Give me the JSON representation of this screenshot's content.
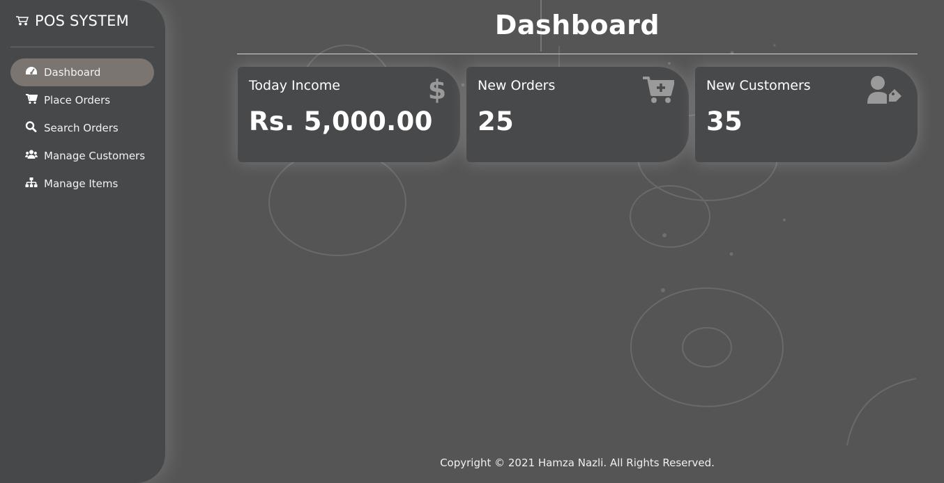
{
  "app": {
    "brand": "POS SYSTEM",
    "brand_icon": "cart-outline-icon"
  },
  "sidebar": {
    "items": [
      {
        "label": "Dashboard",
        "icon": "tachometer-icon",
        "active": true
      },
      {
        "label": "Place Orders",
        "icon": "cart-plus-icon",
        "active": false
      },
      {
        "label": "Search Orders",
        "icon": "search-icon",
        "active": false
      },
      {
        "label": "Manage Customers",
        "icon": "users-icon",
        "active": false
      },
      {
        "label": "Manage Items",
        "icon": "sitemap-icon",
        "active": false
      }
    ]
  },
  "page": {
    "title": "Dashboard"
  },
  "cards": [
    {
      "label": "Today Income",
      "value": "Rs. 5,000.00",
      "icon": "dollar-icon"
    },
    {
      "label": "New Orders",
      "value": "25",
      "icon": "cart-plus-icon"
    },
    {
      "label": "New Customers",
      "value": "35",
      "icon": "user-tag-icon"
    }
  ],
  "footer": {
    "text": "Copyright © 2021 Hamza Nazli. All Rights Reserved."
  },
  "colors": {
    "background": "#555555",
    "sidebar": "#47484a",
    "active_item": "#7a7571",
    "card": "#48494b",
    "icon_muted": "#9a9a9a"
  }
}
